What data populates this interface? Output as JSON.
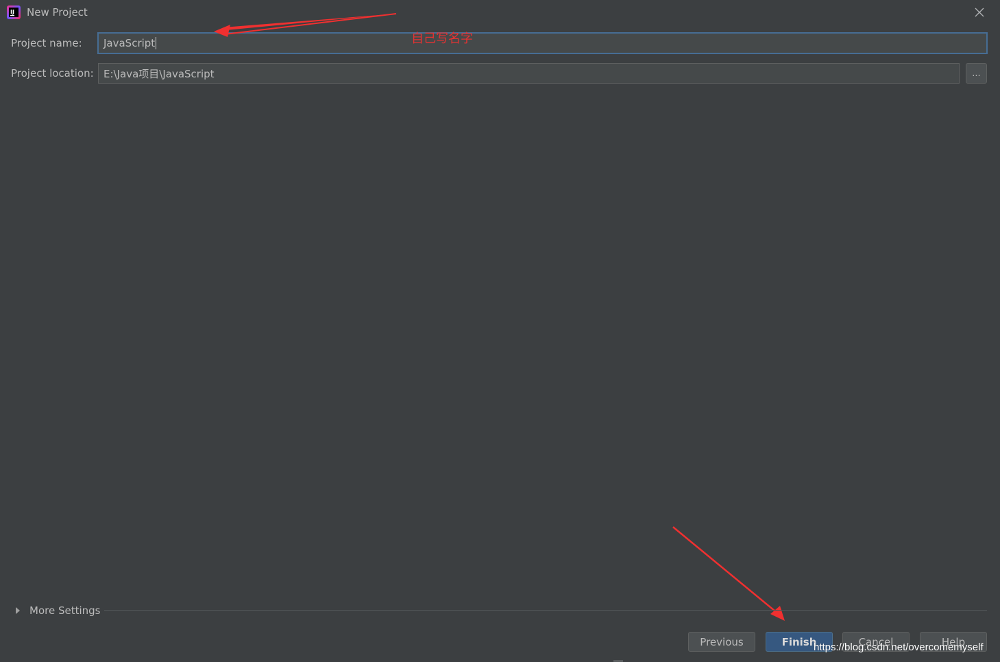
{
  "window": {
    "title": "New Project",
    "app_icon": "intellij-idea-icon",
    "close_icon": "close-icon"
  },
  "form": {
    "project_name_label": "Project name:",
    "project_name_value": "JavaScript",
    "project_location_label": "Project location:",
    "project_location_value": "E:\\Java项目\\JavaScript",
    "browse_label": "..."
  },
  "annotation": {
    "text": "自己写名字",
    "color": "#e63232"
  },
  "more_settings": {
    "label": "More Settings",
    "expand_icon": "triangle-right-icon"
  },
  "buttons": {
    "previous": "Previous",
    "finish": "Finish",
    "cancel": "Cancel",
    "help": "Help"
  },
  "watermark": "https://blog.csdn.net/overcomemyself",
  "colors": {
    "background": "#3c3f41",
    "focus_border": "#466d94",
    "primary_button": "#365880"
  }
}
